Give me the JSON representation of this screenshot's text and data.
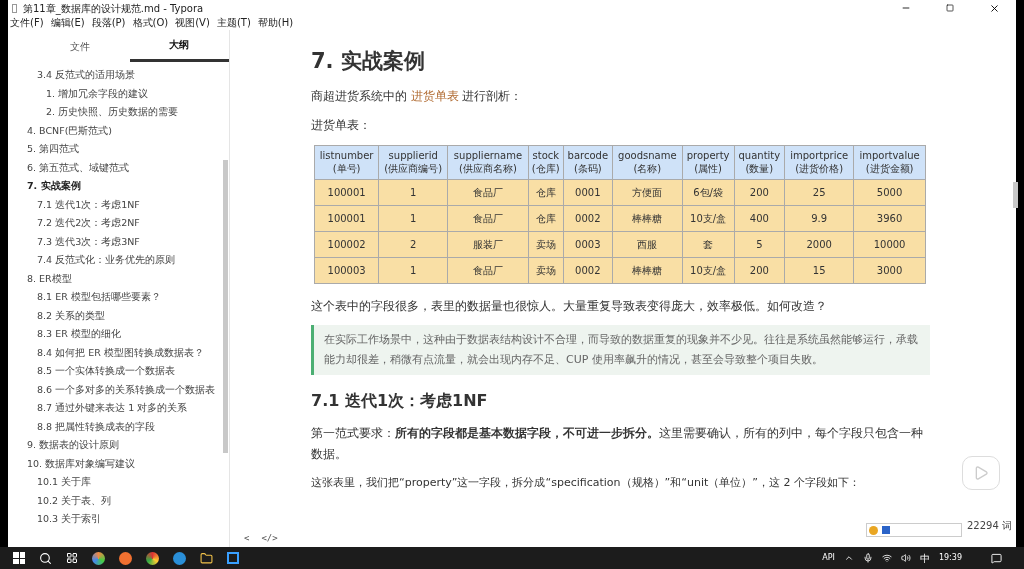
{
  "window": {
    "title": "第11章_数据库的设计规范.md - Typora"
  },
  "menu": [
    "文件(F)",
    "编辑(E)",
    "段落(P)",
    "格式(O)",
    "视图(V)",
    "主题(T)",
    "帮助(H)"
  ],
  "sidebar": {
    "tabs": [
      {
        "label": "文件",
        "selected": false
      },
      {
        "label": "大纲",
        "selected": true
      }
    ],
    "outline": [
      {
        "children": [
          {
            "label": "3.4 反范式的适用场景",
            "selected": false,
            "children": [
              {
                "label": "1. 增加冗余字段的建议",
                "selected": false
              },
              {
                "label": "2. 历史快照、历史数据的需要",
                "selected": false
              }
            ]
          }
        ]
      },
      {
        "label": "4. BCNF(巴斯范式)",
        "selected": false
      },
      {
        "label": "5. 第四范式",
        "selected": false
      },
      {
        "label": "6. 第五范式、域键范式",
        "selected": false
      },
      {
        "label": "7. 实战案例",
        "selected": true,
        "children": [
          {
            "label": "7.1 迭代1次：考虑1NF",
            "selected": false
          },
          {
            "label": "7.2 迭代2次：考虑2NF",
            "selected": false
          },
          {
            "label": "7.3 迭代3次：考虑3NF",
            "selected": false
          },
          {
            "label": "7.4 反范式化：业务优先的原则",
            "selected": false
          }
        ]
      },
      {
        "label": "8. ER模型",
        "selected": false,
        "children": [
          {
            "label": "8.1 ER 模型包括哪些要素？",
            "selected": false
          },
          {
            "label": "8.2 关系的类型",
            "selected": false
          },
          {
            "label": "8.3 ER 模型的细化",
            "selected": false
          },
          {
            "label": "8.4 如何把 ER 模型图转换成数据表？",
            "selected": false
          },
          {
            "label": "8.5 一个实体转换成一个数据表",
            "selected": false
          },
          {
            "label": "8.6 一个多对多的关系转换成一个数据表",
            "selected": false
          },
          {
            "label": "8.7 通过外键来表达 1 对多的关系",
            "selected": false
          },
          {
            "label": "8.8 把属性转换成表的字段",
            "selected": false
          }
        ]
      },
      {
        "label": "9. 数据表的设计原则",
        "selected": false
      },
      {
        "label": "10. 数据库对象编写建议",
        "selected": false,
        "children": [
          {
            "label": "10.1 关于库",
            "selected": false
          },
          {
            "label": "10.2 关于表、列",
            "selected": false
          },
          {
            "label": "10.3 关于索引",
            "selected": false
          }
        ]
      }
    ],
    "footer": [
      "<",
      "</>"
    ]
  },
  "content": {
    "heading": "7. 实战案例",
    "intro": {
      "before": "商超进货系统中的 ",
      "code": "进货单表",
      "after": " 进行剖析："
    },
    "table_caption": "进货单表：",
    "table": {
      "columns": [
        {
          "name": "listnumber",
          "label": "(单号)"
        },
        {
          "name": "supplierid",
          "label": "(供应商编号)"
        },
        {
          "name": "suppliername",
          "label": "(供应商名称)"
        },
        {
          "name": "stock",
          "label": "(仓库)"
        },
        {
          "name": "barcode",
          "label": "(条码)"
        },
        {
          "name": "goodsname",
          "label": "(名称)"
        },
        {
          "name": "property",
          "label": "(属性)"
        },
        {
          "name": "quantity",
          "label": "(数量)"
        },
        {
          "name": "importprice",
          "label": "(进货价格)"
        },
        {
          "name": "importvalue",
          "label": "(进货金额)"
        }
      ],
      "rows": [
        [
          "100001",
          "1",
          "食品厂",
          "仓库",
          "0001",
          "方便面",
          "6包/袋",
          "200",
          "25",
          "5000"
        ],
        [
          "100001",
          "1",
          "食品厂",
          "仓库",
          "0002",
          "棒棒糖",
          "10支/盒",
          "400",
          "9.9",
          "3960"
        ],
        [
          "100002",
          "2",
          "服装厂",
          "卖场",
          "0003",
          "西服",
          "套",
          "5",
          "2000",
          "10000"
        ],
        [
          "100003",
          "1",
          "食品厂",
          "卖场",
          "0002",
          "棒棒糖",
          "10支/盒",
          "200",
          "15",
          "3000"
        ]
      ]
    },
    "after_table": "这个表中的字段很多，表里的数据量也很惊人。大量重复导致表变得庞大，效率极低。如何改造？",
    "quote": "在实际工作场景中，这种由于数据表结构设计不合理，而导致的数据重复的现象并不少见。往往是系统虽然能够运行，承载能力却很差，稍微有点流量，就会出现内存不足、CUP 使用率飙升的情况，甚至会导致整个项目失败。",
    "subheading": "7.1 迭代1次：考虑1NF",
    "para1": "第一范式要求：**所有的字段都是基本数据字段，不可进一步拆分。**这里需要确认，所有的列中，每个字段只包含一种数据。",
    "para2": "这张表里，我们把“property”这一字段，拆分成“specification（规格）”和“unit（单位）”，这 2 个字段如下："
  },
  "status": {
    "word_count": "22294 词"
  },
  "taskbar": {
    "tray": [
      "API",
      "中"
    ],
    "time": "19:39"
  }
}
